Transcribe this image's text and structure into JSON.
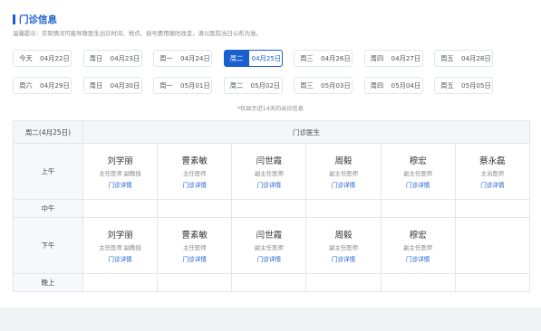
{
  "header": {
    "title": "门诊信息",
    "notice": "温馨提示：实际情况可能导致医生出诊时间、地点、挂号费用随时改变，请以医院当日公布为准。"
  },
  "dates_row1": [
    {
      "weekday": "今天",
      "date": "04月22日"
    },
    {
      "weekday": "周日",
      "date": "04月23日"
    },
    {
      "weekday": "周一",
      "date": "04月24日"
    },
    {
      "weekday": "周二",
      "date": "04月25日"
    },
    {
      "weekday": "周三",
      "date": "04月26日"
    },
    {
      "weekday": "周四",
      "date": "04月27日"
    },
    {
      "weekday": "周五",
      "date": "04月28日"
    }
  ],
  "dates_row2": [
    {
      "weekday": "周六",
      "date": "04月29日"
    },
    {
      "weekday": "周日",
      "date": "04月30日"
    },
    {
      "weekday": "周一",
      "date": "05月01日"
    },
    {
      "weekday": "周二",
      "date": "05月02日"
    },
    {
      "weekday": "周三",
      "date": "05月03日"
    },
    {
      "weekday": "周四",
      "date": "05月04日"
    },
    {
      "weekday": "周五",
      "date": "05月05日"
    }
  ],
  "selected_date_index": 3,
  "range_note": "*仅显示近14天的出诊信息",
  "table": {
    "day_header": "周二(4月25日)",
    "doctors_header": "门诊医生",
    "detail_link": "门诊详情",
    "slots": {
      "morning": "上午",
      "noon": "中午",
      "afternoon": "下午",
      "evening": "晚上"
    },
    "morning": [
      {
        "name": "刘学丽",
        "title": "主任医师 副教授"
      },
      {
        "name": "曹素敏",
        "title": "主任医师"
      },
      {
        "name": "闫世霞",
        "title": "副主任医师"
      },
      {
        "name": "周毅",
        "title": "副主任医师"
      },
      {
        "name": "穆宏",
        "title": "副主任医师"
      },
      {
        "name": "蔡永磊",
        "title": "主治医师"
      }
    ],
    "afternoon": [
      {
        "name": "刘学丽",
        "title": "主任医师 副教授"
      },
      {
        "name": "曹素敏",
        "title": "主任医师"
      },
      {
        "name": "闫世霞",
        "title": "副主任医师"
      },
      {
        "name": "周毅",
        "title": "副主任医师"
      },
      {
        "name": "穆宏",
        "title": "副主任医师"
      }
    ]
  }
}
